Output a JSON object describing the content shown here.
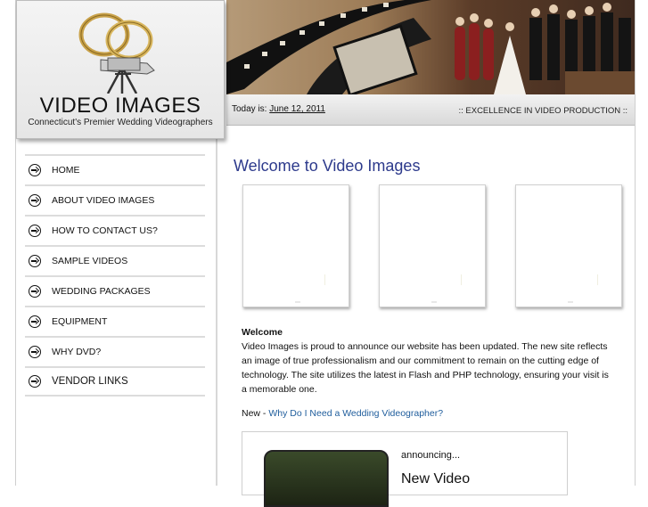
{
  "logo": {
    "title": "VIDEO IMAGES",
    "subtitle": "Connecticut's Premier Wedding Videographers"
  },
  "header": {
    "today_label": "Today is:",
    "today_date": "June 12, 2011",
    "tagline": ":: EXCELLENCE IN VIDEO PRODUCTION ::"
  },
  "nav": {
    "items": [
      {
        "label": "HOME"
      },
      {
        "label": "ABOUT VIDEO IMAGES"
      },
      {
        "label": "HOW TO CONTACT US?"
      },
      {
        "label": "SAMPLE VIDEOS"
      },
      {
        "label": "WEDDING PACKAGES"
      },
      {
        "label": "EQUIPMENT"
      },
      {
        "label": "WHY DVD?"
      },
      {
        "label": "VENDOR LINKS"
      }
    ]
  },
  "main": {
    "heading": "Welcome to Video Images",
    "welcome_title": "Welcome",
    "welcome_body": "Video Images is proud to announce our website has been updated. The new site reflects an image of true professionalism and our commitment to remain on the cutting edge of technology. The site utilizes the latest in Flash and PHP technology, ensuring your visit is a memorable one.",
    "new_prefix": "New - ",
    "new_link": "Why Do I Need a Wedding Videographer?",
    "promo_announcing": "announcing...",
    "promo_title": "New Video"
  },
  "colors": {
    "heading": "#2d3a8c",
    "link": "#1f5d9c"
  }
}
